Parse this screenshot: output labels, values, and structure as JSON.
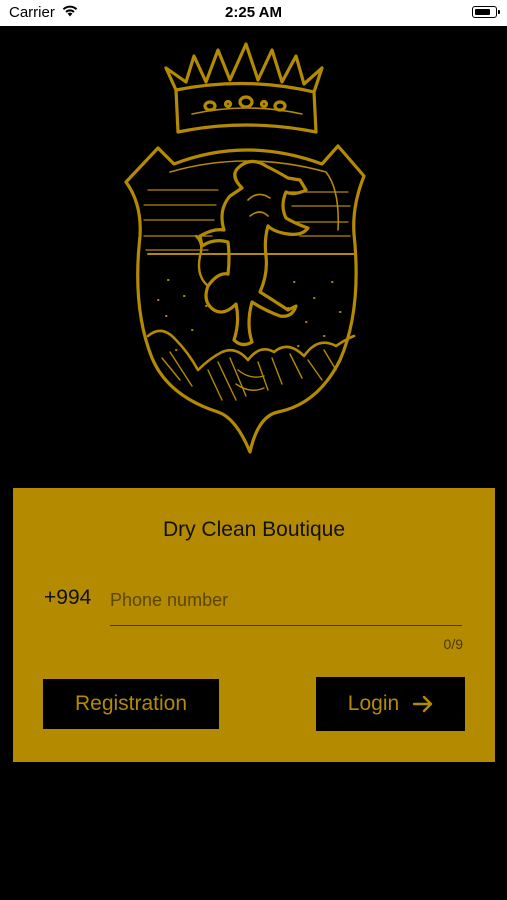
{
  "status_bar": {
    "carrier": "Carrier",
    "time": "2:25 AM",
    "wifi_icon": "wifi-icon",
    "battery_icon": "battery-icon"
  },
  "logo": {
    "icon": "crest-lion-crown-logo"
  },
  "card": {
    "title": "Dry Clean Boutique",
    "phone_prefix": "+994",
    "phone_value": "",
    "phone_placeholder": "Phone number",
    "counter": "0/9",
    "registration_label": "Registration",
    "login_label": "Login",
    "login_icon": "arrow-right-icon"
  },
  "colors": {
    "accent": "#b38a00",
    "background": "#000000",
    "button_bg": "#000000"
  }
}
